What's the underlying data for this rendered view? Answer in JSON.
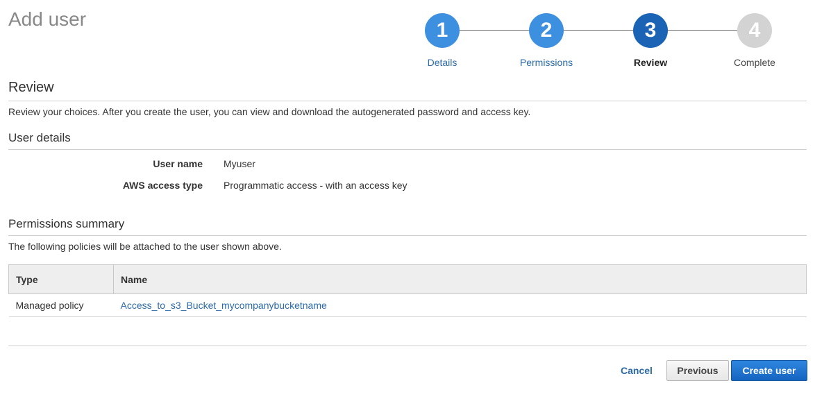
{
  "page": {
    "title": "Add user"
  },
  "wizard": {
    "steps": [
      {
        "number": "1",
        "label": "Details",
        "state": "done"
      },
      {
        "number": "2",
        "label": "Permissions",
        "state": "done"
      },
      {
        "number": "3",
        "label": "Review",
        "state": "current"
      },
      {
        "number": "4",
        "label": "Complete",
        "state": "todo"
      }
    ],
    "colors": {
      "done": "#3d8fdf",
      "current": "#1b64b5",
      "todo": "#d3d3d3"
    }
  },
  "review": {
    "heading": "Review",
    "description": "Review your choices. After you create the user, you can view and download the autogenerated password and access key."
  },
  "user_details": {
    "heading": "User details",
    "rows": [
      {
        "label": "User name",
        "value": "Myuser"
      },
      {
        "label": "AWS access type",
        "value": "Programmatic access - with an access key"
      }
    ]
  },
  "permissions": {
    "heading": "Permissions summary",
    "description": "The following policies will be attached to the user shown above.",
    "columns": [
      "Type",
      "Name"
    ],
    "rows": [
      {
        "type": "Managed policy",
        "name": "Access_to_s3_Bucket_mycompanybucketname"
      }
    ]
  },
  "footer": {
    "cancel_label": "Cancel",
    "previous_label": "Previous",
    "create_label": "Create user"
  },
  "colors": {
    "primary": "#1565c0",
    "link": "#2a6aa8"
  }
}
